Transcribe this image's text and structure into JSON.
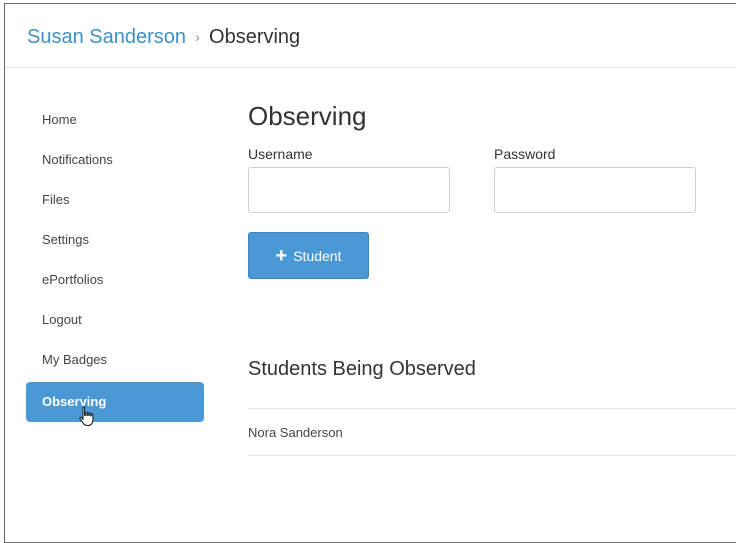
{
  "breadcrumb": {
    "user": "Susan Sanderson",
    "separator": "›",
    "current": "Observing"
  },
  "sidebar": {
    "items": [
      {
        "label": "Home",
        "active": false
      },
      {
        "label": "Notifications",
        "active": false
      },
      {
        "label": "Files",
        "active": false
      },
      {
        "label": "Settings",
        "active": false
      },
      {
        "label": "ePortfolios",
        "active": false
      },
      {
        "label": "Logout",
        "active": false
      },
      {
        "label": "My Badges",
        "active": false
      },
      {
        "label": "Observing",
        "active": true
      }
    ]
  },
  "main": {
    "title": "Observing",
    "username_label": "Username",
    "username_value": "",
    "password_label": "Password",
    "password_value": "",
    "add_button_icon": "+",
    "add_button_label": "Student",
    "section_title": "Students Being Observed",
    "students": [
      "Nora Sanderson"
    ]
  },
  "icons": {
    "cursor": "hand-pointer-icon",
    "add": "plus-icon"
  },
  "colors": {
    "link": "#3f8fc6",
    "accent": "#4a98d4",
    "text": "#333333"
  }
}
